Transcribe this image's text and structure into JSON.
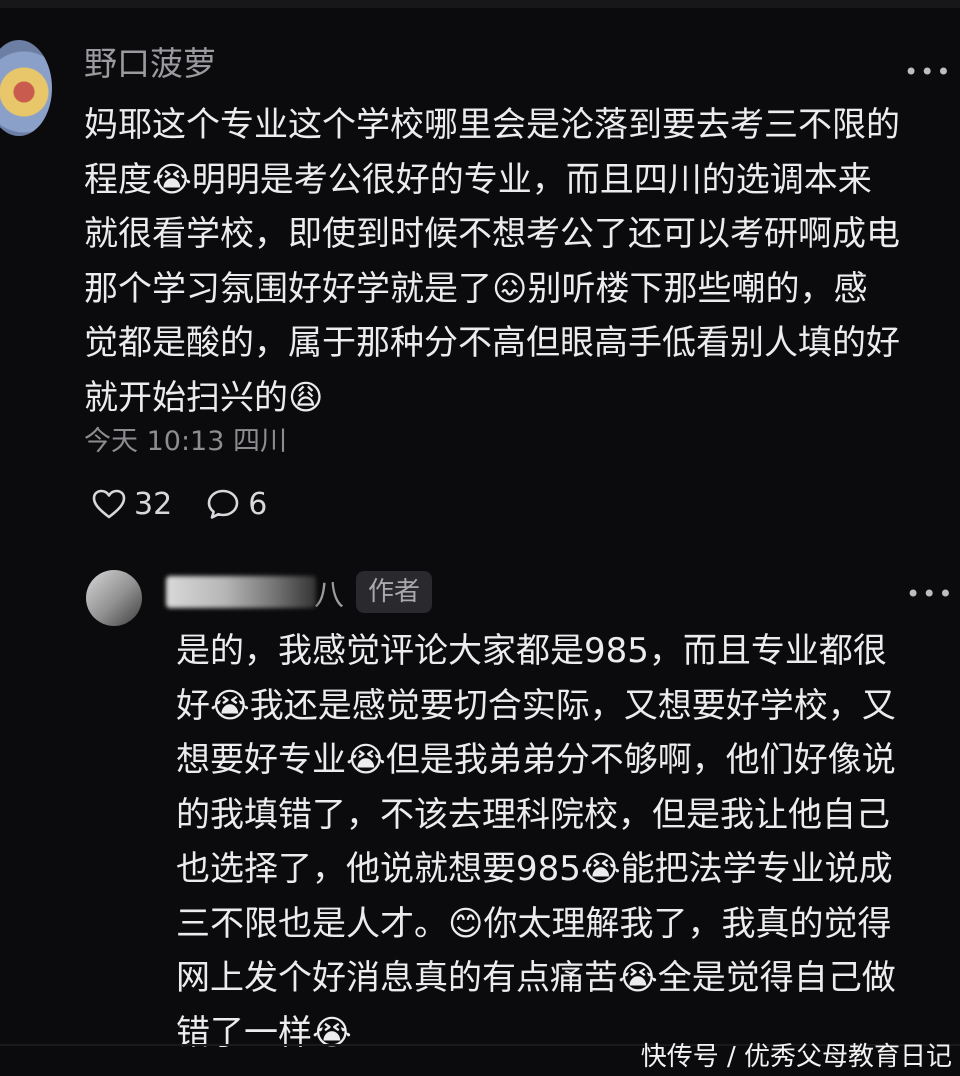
{
  "comment": {
    "username": "野口菠萝",
    "more_icon": "ellipsis-icon",
    "text": "妈耶这个专业这个学校哪里会是沦落到要去考三不限的\n程度😭明明是考公很好的专业，而且四川的选调本来\n就很看学校，即使到时候不想考公了还可以考研啊成电\n那个学习氛围好好学就是了😖别听楼下那些嘲的，感\n觉都是酸的，属于那种分不高但眼高手低看别人填的好\n就开始扫兴的😩",
    "meta": "今天 10:13 四川",
    "likes": "32",
    "replies": "6"
  },
  "reply": {
    "username_visible_part": "八",
    "author_badge": "作者",
    "more_icon": "ellipsis-icon",
    "text": "是的，我感觉评论大家都是985，而且专业都很\n好😭我还是感觉要切合实际，又想要好学校，又\n想要好专业😭但是我弟弟分不够啊，他们好像说\n的我填错了，不该去理科院校，但是我让他自己\n也选择了，他说就想要985😭能把法学专业说成\n三不限也是人才。😊你太理解我了，我真的觉得\n网上发个好消息真的有点痛苦😭全是觉得自己做\n错了一样😭"
  },
  "watermark": "快传号 / 优秀父母教育日记"
}
